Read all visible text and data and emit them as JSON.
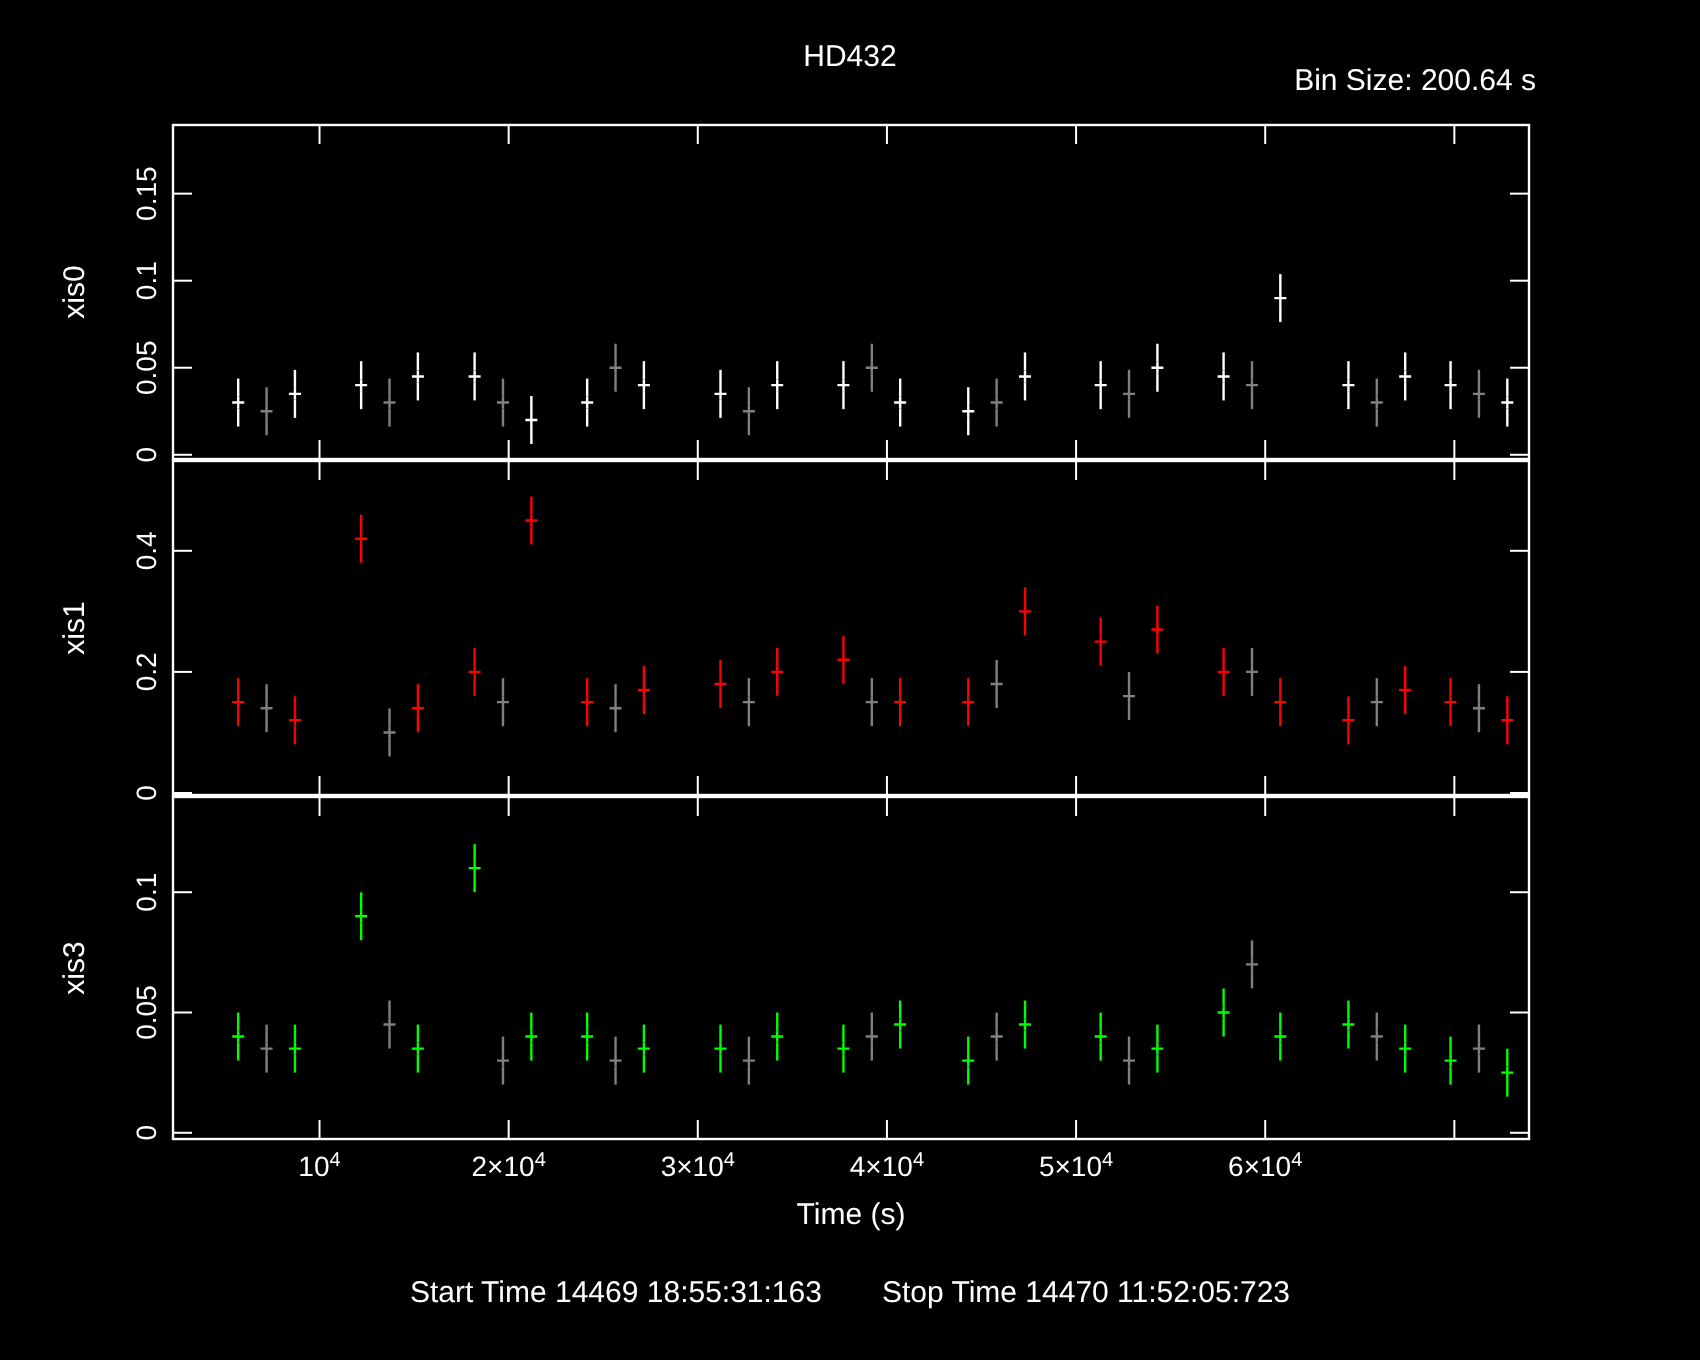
{
  "title": "HD432",
  "bin_size": "Bin Size: 200.64 s",
  "panels": [
    {
      "chart_data": {
        "type": "scatter",
        "ylabel": "xis0",
        "xlim": [
          2200,
          74000
        ],
        "ylim": [
          -0.003,
          0.19
        ],
        "yticks": [
          0,
          0.05,
          0.1,
          0.15
        ],
        "series": [
          {
            "color": "#ffffff",
            "x": [
              5700,
              8700,
              12200,
              15200,
              18200,
              21200,
              24150,
              27150,
              31200,
              34200,
              37700,
              40700,
              44300,
              47300,
              51300,
              54300,
              57800,
              60800,
              64400,
              67400,
              69800,
              72800
            ],
            "values": [
              0.03,
              0.035,
              0.04,
              0.045,
              0.045,
              0.02,
              0.03,
              0.04,
              0.035,
              0.04,
              0.04,
              0.03,
              0.025,
              0.045,
              0.04,
              0.05,
              0.045,
              0.09,
              0.04,
              0.045,
              0.04,
              0.03
            ]
          },
          {
            "color": "#808080",
            "x": [
              7200,
              13700,
              19700,
              25650,
              32700,
              39200,
              45800,
              52800,
              59300,
              65900,
              71300
            ],
            "values": [
              0.025,
              0.03,
              0.03,
              0.05,
              0.025,
              0.05,
              0.03,
              0.035,
              0.04,
              0.03,
              0.035
            ]
          }
        ]
      }
    },
    {
      "chart_data": {
        "type": "scatter",
        "ylabel": "xis1",
        "xlim": [
          2200,
          74000
        ],
        "ylim": [
          -0.005,
          0.55
        ],
        "yticks": [
          0,
          0.2,
          0.4
        ],
        "series": [
          {
            "color": "#ff0000",
            "x": [
              5700,
              8700,
              12200,
              15200,
              18200,
              21200,
              24150,
              27150,
              31200,
              34200,
              37700,
              40700,
              44300,
              47300,
              51300,
              54300,
              57800,
              60800,
              64400,
              67400,
              69800,
              72800
            ],
            "values": [
              0.15,
              0.12,
              0.42,
              0.14,
              0.2,
              0.45,
              0.15,
              0.17,
              0.18,
              0.2,
              0.22,
              0.15,
              0.15,
              0.3,
              0.25,
              0.27,
              0.2,
              0.15,
              0.12,
              0.17,
              0.15,
              0.12
            ]
          },
          {
            "color": "#808080",
            "x": [
              7200,
              13700,
              19700,
              25650,
              32700,
              39200,
              45800,
              52800,
              59300,
              65900,
              71300
            ],
            "values": [
              0.14,
              0.1,
              0.15,
              0.14,
              0.15,
              0.15,
              0.18,
              0.16,
              0.2,
              0.15,
              0.14
            ]
          }
        ]
      }
    },
    {
      "chart_data": {
        "type": "scatter",
        "ylabel": "xis3",
        "xlabel": "Time (s)",
        "xlim": [
          2200,
          74000
        ],
        "ylim": [
          -0.003,
          0.14
        ],
        "yticks": [
          0,
          0.05,
          0.1
        ],
        "xticks": [
          {
            "value": 10000,
            "label": "10$^{4}$"
          },
          {
            "value": 20000,
            "label": "2×10$^{4}$"
          },
          {
            "value": 30000,
            "label": "3×10$^{4}$"
          },
          {
            "value": 40000,
            "label": "4×10$^{4}$"
          },
          {
            "value": 50000,
            "label": "5×10$^{4}$"
          },
          {
            "value": 60000,
            "label": "6×10$^{4}$"
          }
        ],
        "series": [
          {
            "color": "#00ff00",
            "x": [
              5700,
              8700,
              12200,
              15200,
              18200,
              21200,
              24150,
              27150,
              31200,
              34200,
              37700,
              40700,
              44300,
              47300,
              51300,
              54300,
              57800,
              60800,
              64400,
              67400,
              69800,
              72800
            ],
            "values": [
              0.04,
              0.035,
              0.09,
              0.035,
              0.11,
              0.04,
              0.04,
              0.035,
              0.035,
              0.04,
              0.035,
              0.045,
              0.03,
              0.045,
              0.04,
              0.035,
              0.05,
              0.04,
              0.045,
              0.035,
              0.03,
              0.025
            ]
          },
          {
            "color": "#808080",
            "x": [
              7200,
              13700,
              19700,
              25650,
              32700,
              39200,
              45800,
              52800,
              59300,
              65900,
              71300
            ],
            "values": [
              0.035,
              0.045,
              0.03,
              0.03,
              0.03,
              0.04,
              0.04,
              0.03,
              0.07,
              0.04,
              0.035
            ]
          }
        ]
      }
    }
  ],
  "start_time": "Start Time 14469 18:55:31:163",
  "stop_time": "Stop Time 14470 11:52:05:723"
}
